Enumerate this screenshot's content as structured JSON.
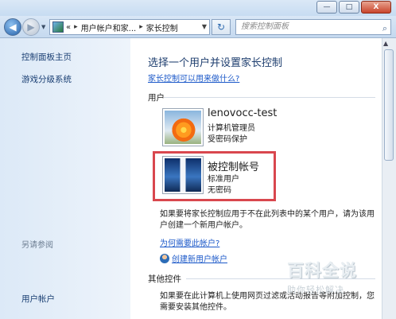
{
  "window": {
    "minimize": "—",
    "maximize": "□",
    "close": "X"
  },
  "nav": {
    "back": "◀",
    "forward": "▶",
    "breadcrumb": [
      "«",
      "用户帐户和家...",
      "家长控制"
    ],
    "refresh": "↻",
    "search_placeholder": "搜索控制面板"
  },
  "sidebar": {
    "items": [
      "控制面板主页",
      "游戏分级系统"
    ],
    "see_also_label": "另请参阅",
    "see_also_items": [
      "用户帐户"
    ]
  },
  "main": {
    "heading": "选择一个用户并设置家长控制",
    "help_link": "家长控制可以用来做什么?",
    "users_label": "用户",
    "users": [
      {
        "name": "lenovocc-test",
        "role": "计算机管理员",
        "password": "受密码保护",
        "picture": "orange-flower"
      },
      {
        "name": "被控制帐号",
        "role": "标准用户",
        "password": "无密码",
        "picture": "lighthouse-tower"
      }
    ],
    "missing_user_text": "如果要将家长控制应用于不在此列表中的某个用户，请为该用户创建一个新用户帐户。",
    "why_link": "为何需要此帐户?",
    "create_link": "创建新用户帐户",
    "other_controls_label": "其他控件",
    "other_controls_text": "如果要在此计算机上使用网页过滤或活动报告等附加控制，您需要安装其他控件。"
  },
  "watermark": {
    "title": "百科全说",
    "subtitle": "助你轻松解决"
  },
  "colors": {
    "highlight_border": "#d9474e",
    "link": "#1c59c9",
    "sidebar_bg": "#dce9f7"
  }
}
